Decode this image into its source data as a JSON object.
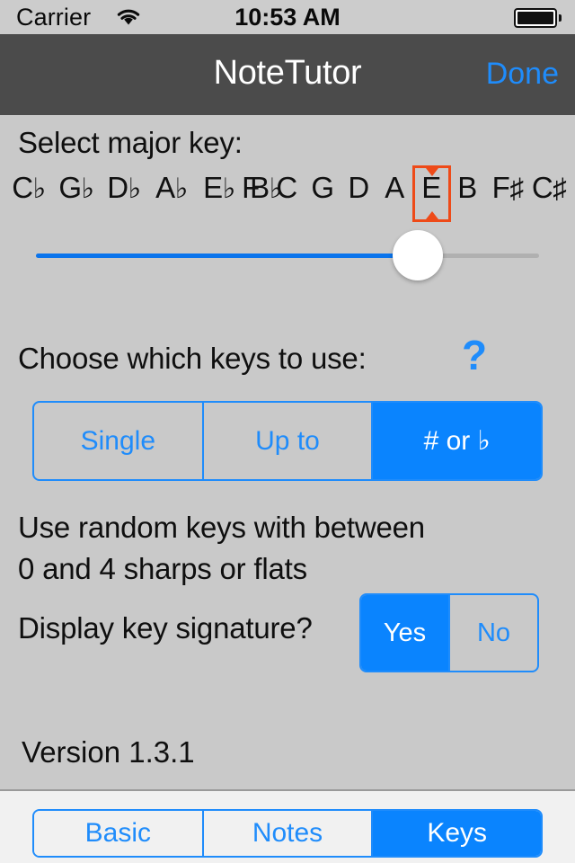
{
  "status_bar": {
    "carrier": "Carrier",
    "wifi_icon": "wifi-icon",
    "time": "10:53 AM",
    "battery_icon": "battery-full-icon"
  },
  "nav_bar": {
    "title": "NoteTutor",
    "done_label": "Done"
  },
  "key_selector": {
    "label": "Select major key:",
    "keys": [
      {
        "letter": "C",
        "accidental": "♭"
      },
      {
        "letter": "G",
        "accidental": "♭"
      },
      {
        "letter": "D",
        "accidental": "♭"
      },
      {
        "letter": "A",
        "accidental": "♭"
      },
      {
        "letter": "E",
        "accidental": "♭"
      },
      {
        "letter": "B",
        "accidental": "♭"
      },
      {
        "letter": "F",
        "accidental": ""
      },
      {
        "letter": "C",
        "accidental": ""
      },
      {
        "letter": "G",
        "accidental": ""
      },
      {
        "letter": "D",
        "accidental": ""
      },
      {
        "letter": "A",
        "accidental": ""
      },
      {
        "letter": "E",
        "accidental": ""
      },
      {
        "letter": "B",
        "accidental": ""
      },
      {
        "letter": "F",
        "accidental": "♯"
      },
      {
        "letter": "C",
        "accidental": "♯"
      }
    ],
    "selected_index": 11,
    "selected_key": "E",
    "highlight_color": "#ee4a18",
    "slider": {
      "value_index": 11,
      "min_index": 0,
      "max_index": 14,
      "fill_color": "#0a74ec",
      "track_color": "#b0b0b0"
    }
  },
  "choose_keys": {
    "label": "Choose which keys to use:",
    "help_icon_label": "?",
    "options": [
      "Single",
      "Up to",
      "# or ♭"
    ],
    "selected": "# or ♭",
    "selected_index": 2,
    "description_line_1": "Use random keys with between",
    "description_line_2": "0 and 4 sharps or flats"
  },
  "display_signature": {
    "label": "Display key signature?",
    "options": [
      "Yes",
      "No"
    ],
    "selected": "Yes",
    "selected_index": 0
  },
  "version": {
    "text": "Version 1.3.1"
  },
  "tab_bar": {
    "tabs": [
      "Basic",
      "Notes",
      "Keys"
    ],
    "selected": "Keys",
    "selected_index": 2
  },
  "colors": {
    "accent_blue": "#0a84fe",
    "tint_blue": "#1f8cfb",
    "highlight_orange": "#ee4a18",
    "nav_gray": "#4b4b4b",
    "page_gray": "#c9c9c9"
  }
}
